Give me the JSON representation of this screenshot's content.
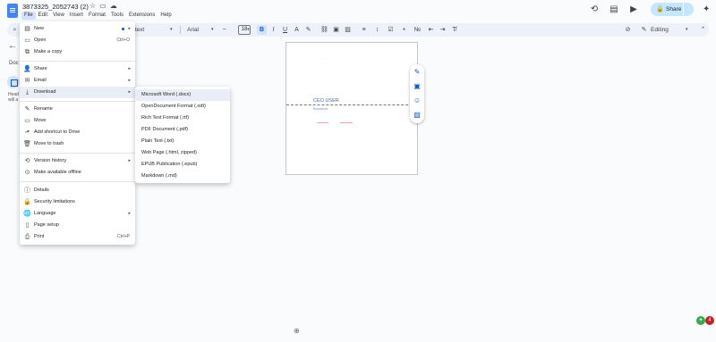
{
  "header": {
    "doc_title": "3873325_2052743 (2)",
    "menu": [
      "File",
      "Edit",
      "View",
      "Insert",
      "Format",
      "Tools",
      "Extensions",
      "Help"
    ],
    "share_label": "Share"
  },
  "toolbar": {
    "style": "Normal text",
    "font": "Arial",
    "font_size": "18",
    "mode": "Editing"
  },
  "left_panel": {
    "tab_label": "Doc",
    "hint_line1": "Head",
    "hint_line2": "will a"
  },
  "document": {
    "faded_line1": "· · · · ·",
    "faded_line2": "· · · ·",
    "ceo_text": "CEO USER",
    "sub_text": "Business"
  },
  "file_menu": {
    "new": "New",
    "open": "Open",
    "open_shortcut": "Ctrl+O",
    "make_copy": "Make a copy",
    "share": "Share",
    "email": "Email",
    "download": "Download",
    "rename": "Rename",
    "move": "Move",
    "add_shortcut": "Add shortcut to Drive",
    "move_trash": "Move to trash",
    "version_history": "Version history",
    "offline": "Make available offline",
    "details": "Details",
    "security": "Security limitations",
    "language": "Language",
    "page_setup": "Page setup",
    "print": "Print",
    "print_shortcut": "Ctrl+P"
  },
  "download_menu": [
    "Microsoft Word (.docx)",
    "OpenDocument Format (.odt)",
    "Rich Text Format (.rtf)",
    "PDF Document (.pdf)",
    "Plain Text (.txt)",
    "Web Page (.html, zipped)",
    "EPUB Publication (.epub)",
    "Markdown (.md)"
  ],
  "notifications": {
    "count": "4"
  },
  "colors": {
    "accent": "#0b57d0",
    "share_bg": "#c2e7ff",
    "menu_hover": "#e9eef6"
  }
}
